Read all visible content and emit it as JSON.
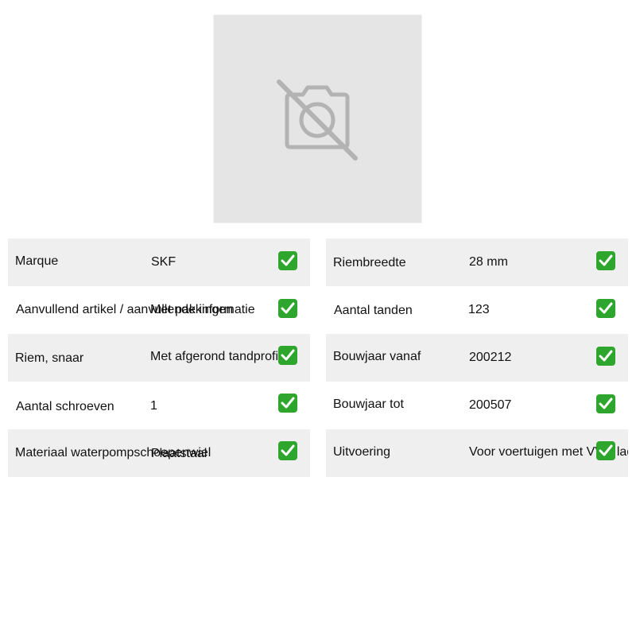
{
  "product_image": {
    "icon": "no-camera-icon"
  },
  "specs_left": [
    {
      "label": "Marque",
      "value": "SKF"
    },
    {
      "label": "Aanvullend artikel / aanvullende informatie",
      "value": "Met pakkingen"
    },
    {
      "label": "Riem, snaar",
      "value": "Met afgerond tandprofiel"
    },
    {
      "label": "Aantal schroeven",
      "value": "1"
    },
    {
      "label": "Materiaal waterpompschoepenwiel",
      "value": "Plaatstaal"
    }
  ],
  "specs_right": [
    {
      "label": "Riembreedte",
      "value": "28 mm"
    },
    {
      "label": "Aantal tanden",
      "value": "123"
    },
    {
      "label": "Bouwjaar vanaf",
      "value": "200212"
    },
    {
      "label": "Bouwjaar tot",
      "value": "200507"
    },
    {
      "label": "Uitvoering",
      "value": "Voor voertuigen met VVG laden"
    }
  ],
  "colors": {
    "check": "#2ea62e",
    "row_shade": "#efefef",
    "placeholder_bg": "#e5e5e5",
    "placeholder_icon": "#b3b3b3"
  }
}
